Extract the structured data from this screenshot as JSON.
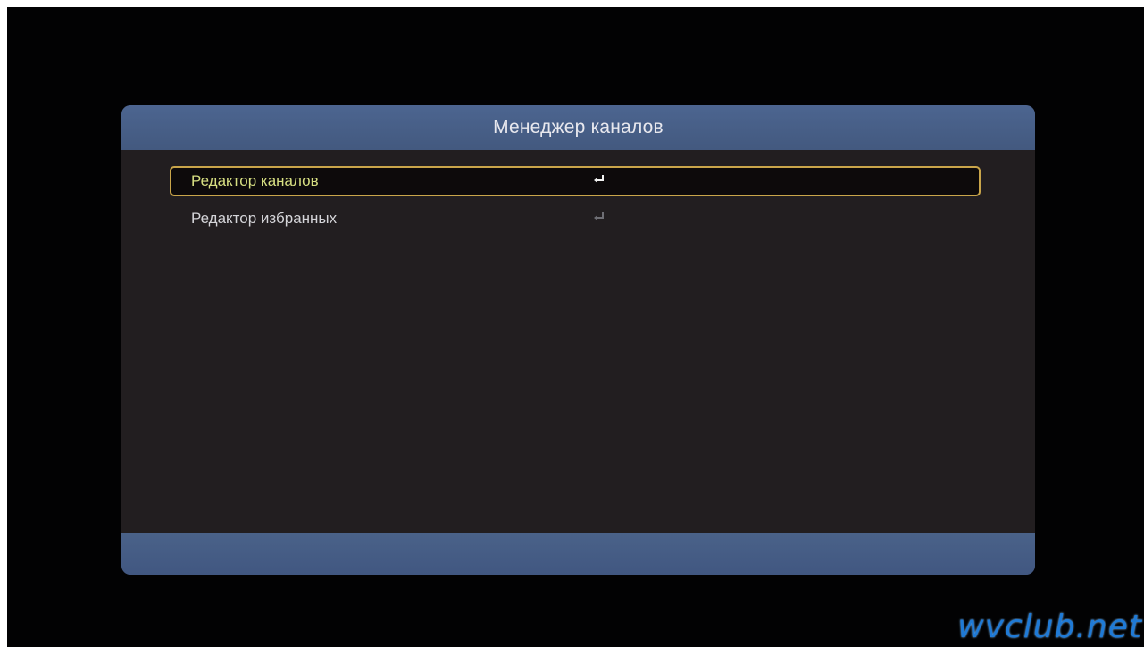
{
  "dialog": {
    "title": "Менеджер каналов"
  },
  "menu": {
    "items": [
      {
        "label": "Редактор каналов",
        "icon": "enter-icon",
        "selected": true
      },
      {
        "label": "Редактор избранных",
        "icon": "enter-icon",
        "selected": false
      }
    ]
  },
  "watermark": "wvclub.net",
  "colors": {
    "header": "#4c6590",
    "panel": "#221e20",
    "selection_border": "#c9a54a",
    "selected_text": "#d7df82",
    "text": "#d4d4d8"
  }
}
